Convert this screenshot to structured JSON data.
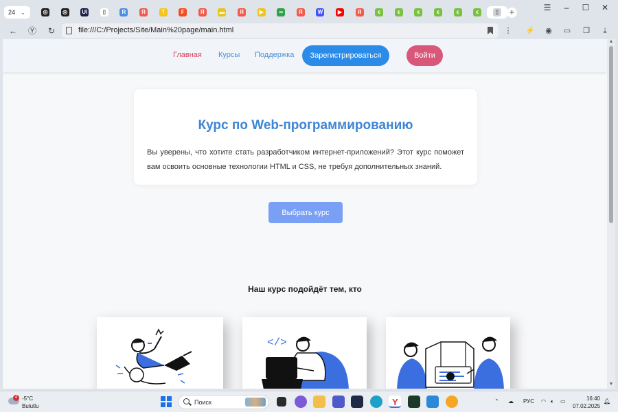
{
  "browser": {
    "tab_count": "24",
    "tabs": [
      {
        "icon": "globe-icon",
        "color": "#222222",
        "glyph": "◎"
      },
      {
        "icon": "chatgpt-icon",
        "color": "#222222",
        "glyph": "◎"
      },
      {
        "icon": "ui-app-icon",
        "color": "#1b1f4a",
        "glyph": "UI"
      },
      {
        "icon": "file-icon",
        "color": "#ffffff",
        "glyph": "▯"
      },
      {
        "icon": "r-icon",
        "color": "#4a90e2",
        "glyph": "R"
      },
      {
        "icon": "yandex-icon",
        "color": "#f25a4a",
        "glyph": "Я"
      },
      {
        "icon": "t-icon",
        "color": "#f5c518",
        "glyph": "T"
      },
      {
        "icon": "figma-icon",
        "color": "#f24e1e",
        "glyph": "F"
      },
      {
        "icon": "yandex-icon",
        "color": "#f25a4a",
        "glyph": "Я"
      },
      {
        "icon": "yellow-tab-icon",
        "color": "#e8c51b",
        "glyph": "▬"
      },
      {
        "icon": "yandex-icon",
        "color": "#f25a4a",
        "glyph": "Я"
      },
      {
        "icon": "play-icon",
        "color": "#f0c419",
        "glyph": "▶"
      },
      {
        "icon": "link-icon",
        "color": "#2fa24b",
        "glyph": "∞"
      },
      {
        "icon": "yandex-icon",
        "color": "#f25a4a",
        "glyph": "Я"
      },
      {
        "icon": "webflow-icon",
        "color": "#4353ff",
        "glyph": "W"
      },
      {
        "icon": "youtube-icon",
        "color": "#ff0000",
        "glyph": "▶"
      },
      {
        "icon": "yandex-icon",
        "color": "#f25a4a",
        "glyph": "Я"
      },
      {
        "icon": "green-tab-icon",
        "color": "#7ac143",
        "glyph": "ϵ"
      },
      {
        "icon": "green-tab-icon",
        "color": "#7ac143",
        "glyph": "ϵ"
      },
      {
        "icon": "green-tab-icon",
        "color": "#7ac143",
        "glyph": "ϵ"
      },
      {
        "icon": "green-tab-icon",
        "color": "#7ac143",
        "glyph": "ϵ"
      },
      {
        "icon": "green-tab-icon",
        "color": "#7ac143",
        "glyph": "ϵ"
      },
      {
        "icon": "green-tab-icon",
        "color": "#7ac143",
        "glyph": "ϵ"
      },
      {
        "icon": "page-icon",
        "color": "#cfd3da",
        "glyph": "▯",
        "active": true
      }
    ],
    "url": "file:///C:/Projects/Site/Main%20page/main.html"
  },
  "site": {
    "nav": {
      "home": "Главная",
      "courses": "Курсы",
      "support": "Поддержка",
      "register": "Зарегистрироваться",
      "login": "Войти"
    },
    "hero": {
      "title": "Курс по Web-программированию",
      "text": "Вы уверены, что хотите стать разработчиком интернет-приложений? Этот курс поможет вам освоить основные технологии HTML и CSS, не требуя дополнительных знаний."
    },
    "choose_button": "Выбрать курс",
    "section_title": "Наш курс подойдёт тем, кто",
    "colors": {
      "accent_blue": "#3d86d4",
      "link_blue": "#4a90d9",
      "home_red": "#d6455f",
      "register_blue": "#2b8be8",
      "login_pink": "#d9587a",
      "choose_blue": "#7aa0f5",
      "illustration_blue": "#3b6fe0"
    }
  },
  "taskbar": {
    "weather_badge": "4",
    "temperature": "-5°C",
    "condition": "Bulutlu",
    "search_placeholder": "Поиск",
    "language": "РУС",
    "time": "16:40",
    "date": "07.02.2025"
  }
}
